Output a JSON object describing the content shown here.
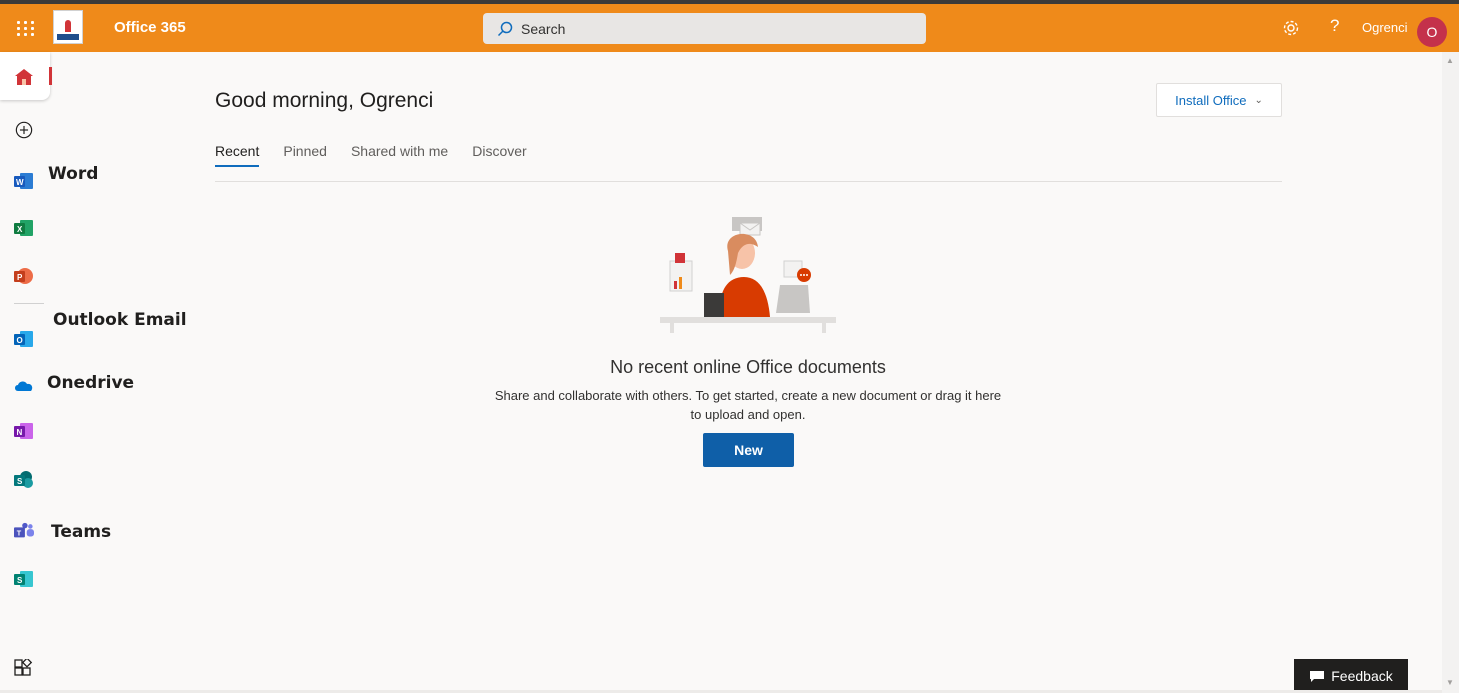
{
  "header": {
    "app_title": "Office 365",
    "search_placeholder": "Search",
    "username": "Ogrenci",
    "avatar_initial": "O",
    "brand_color": "#ef8a1a"
  },
  "rail": {
    "items": [
      {
        "name": "home",
        "icon": "home-icon",
        "label": ""
      },
      {
        "name": "create",
        "icon": "plus-circle-icon",
        "label": ""
      },
      {
        "name": "word",
        "icon": "word-icon",
        "label": "Word"
      },
      {
        "name": "excel",
        "icon": "excel-icon",
        "label": ""
      },
      {
        "name": "powerpoint",
        "icon": "powerpoint-icon",
        "label": ""
      },
      {
        "name": "outlook",
        "icon": "outlook-icon",
        "label": "Outlook Email"
      },
      {
        "name": "onedrive",
        "icon": "onedrive-icon",
        "label": "Onedrive"
      },
      {
        "name": "onenote",
        "icon": "onenote-icon",
        "label": ""
      },
      {
        "name": "sharepoint",
        "icon": "sharepoint-icon",
        "label": ""
      },
      {
        "name": "teams",
        "icon": "teams-icon",
        "label": "Teams"
      },
      {
        "name": "sway",
        "icon": "sway-icon",
        "label": ""
      },
      {
        "name": "all-apps",
        "icon": "all-apps-icon",
        "label": ""
      }
    ]
  },
  "main": {
    "greeting": "Good morning, Ogrenci",
    "install_label": "Install Office",
    "tabs": [
      {
        "label": "Recent",
        "active": true
      },
      {
        "label": "Pinned",
        "active": false
      },
      {
        "label": "Shared with me",
        "active": false
      },
      {
        "label": "Discover",
        "active": false
      }
    ],
    "empty_title": "No recent online Office documents",
    "empty_line1": "Share and collaborate with others. To get started, create a new document or drag it here",
    "empty_line2": "to upload and open.",
    "new_label": "New"
  },
  "feedback_label": "Feedback"
}
